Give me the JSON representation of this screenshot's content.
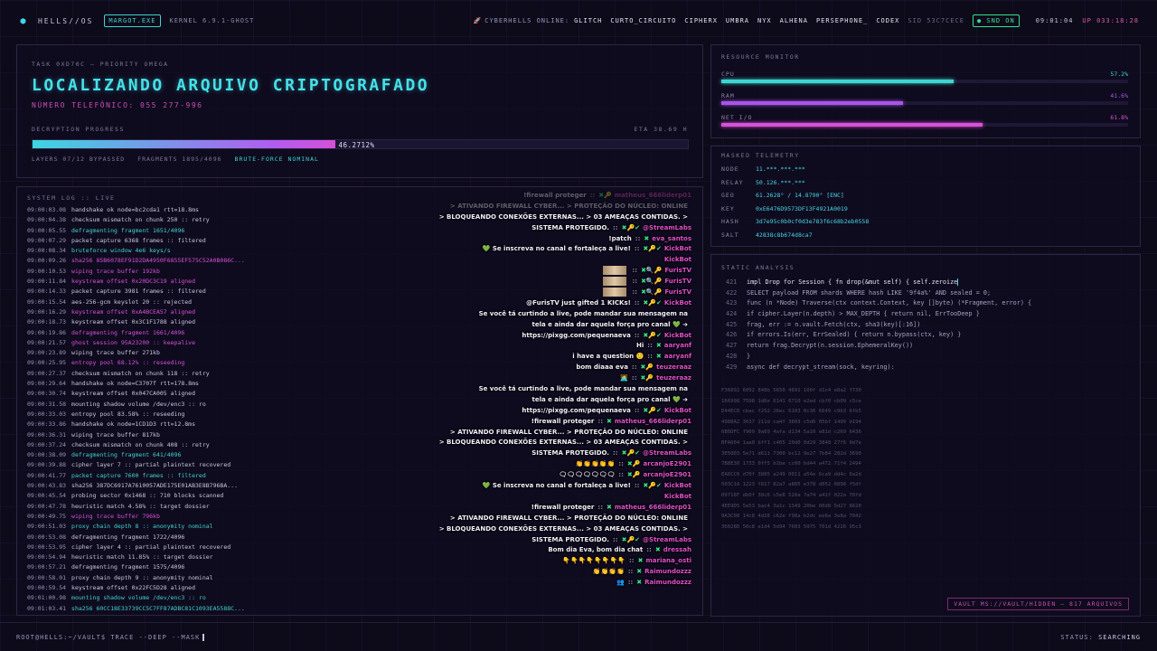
{
  "topbar": {
    "brand": "HELLS//OS",
    "process": "MARGOT.EXE",
    "kernel": "KERNEL 6.9.1-GHOST",
    "online_label": "CYBERHELLS ONLINE:",
    "users": [
      "GLITCH",
      "CURTO_CIRCUITO",
      "CIPHERX",
      "UMBRA",
      "NYX",
      "ALHENA",
      "PERSEPHONE_",
      "CODEX"
    ],
    "sid": "SID 53C7CECE",
    "snd": "SND ON",
    "clock": "09:01:04",
    "uptime": "UP 033:18:28"
  },
  "task": {
    "label": "TASK 0XD70C — PRIORITY OMEGA",
    "heading": "LOCALIZANDO ARQUIVO CRIPTOGRAFADO",
    "phone": "NÚMERO TELEFÔNICO: 055 277-996",
    "progress_label": "DECRYPTION PROGRESS",
    "eta": "ETA 38.69 H",
    "progress_value": 0.462712,
    "progress_text": "46.2712%",
    "stats": [
      "LAYERS 07/12 BYPASSED",
      "FRAGMENTS 1895/4096",
      "BRUTE-FORCE NOMINAL"
    ]
  },
  "log": {
    "title": "SYSTEM LOG :: LIVE",
    "lines": [
      {
        "t": "09:00:03.08",
        "m": "handshake ok node=bc2cda1 rtt=18.8ms",
        "c": ""
      },
      {
        "t": "09:00:04.38",
        "m": "checksum mismatch on chunk 250 :: retry",
        "c": ""
      },
      {
        "t": "09:00:05.55",
        "m": "defragmenting fragment 1651/4096",
        "c": "cyan"
      },
      {
        "t": "09:00:07.29",
        "m": "packet capture 6368 frames :: filtered",
        "c": ""
      },
      {
        "t": "09:00:08.34",
        "m": "bruteforce window 4e6 keys/s",
        "c": "cyan"
      },
      {
        "t": "09:00:09.26",
        "m": "sha256 85B6078EF91D2DA4950F6855EF575C52A0B086C...",
        "c": "mag"
      },
      {
        "t": "09:00:10.53",
        "m": "wiping trace buffer 192kb",
        "c": "mag"
      },
      {
        "t": "09:00:11.84",
        "m": "keystream offset 0x20DC3C19 aligned",
        "c": "mag"
      },
      {
        "t": "09:00:14.33",
        "m": "packet capture 3981 frames :: filtered",
        "c": ""
      },
      {
        "t": "09:00:15.54",
        "m": "aes-256-gcm keyslot 20 :: rejected",
        "c": ""
      },
      {
        "t": "09:00:16.29",
        "m": "keystream offset 0xA4BCEA57 aligned",
        "c": "mag"
      },
      {
        "t": "09:00:18.73",
        "m": "keystream offset 0x3C1F1788 aligned",
        "c": ""
      },
      {
        "t": "09:00:19.86",
        "m": "defragmenting fragment 1661/4096",
        "c": "mag"
      },
      {
        "t": "09:00:21.57",
        "m": "ghost session 95A23200 :: keepalive",
        "c": "mag"
      },
      {
        "t": "09:00:23.89",
        "m": "wiping trace buffer 271kb",
        "c": ""
      },
      {
        "t": "09:00:25.95",
        "m": "entropy pool 68.12% :: reseeding",
        "c": "mag"
      },
      {
        "t": "09:00:27.37",
        "m": "checksum mismatch on chunk 118 :: retry",
        "c": ""
      },
      {
        "t": "09:00:29.64",
        "m": "handshake ok node=C3707f rtt=178.8ms",
        "c": ""
      },
      {
        "t": "09:00:30.74",
        "m": "keystream offset 0x047CA005 aligned",
        "c": ""
      },
      {
        "t": "09:00:31.58",
        "m": "mounting shadow volume /dev/enc3 :: ro",
        "c": ""
      },
      {
        "t": "09:00:33.03",
        "m": "entropy pool 83.58% :: reseeding",
        "c": ""
      },
      {
        "t": "09:00:33.86",
        "m": "handshake ok node=1CD1D3 rtt=12.8ms",
        "c": ""
      },
      {
        "t": "09:00:36.31",
        "m": "wiping trace buffer 817kb",
        "c": ""
      },
      {
        "t": "09:00:37.24",
        "m": "checksum mismatch on chunk 408 :: retry",
        "c": ""
      },
      {
        "t": "09:00:38.09",
        "m": "defragmenting fragment 641/4096",
        "c": "cyan"
      },
      {
        "t": "09:00:39.88",
        "m": "cipher layer 7 :: partial plaintext recovered",
        "c": ""
      },
      {
        "t": "09:00:41.77",
        "m": "packet capture 7600 frames :: filtered",
        "c": "cyan"
      },
      {
        "t": "09:00:43.83",
        "m": "sha256 387DC6917A7610057ADE175E01AB3E8B796BA...",
        "c": ""
      },
      {
        "t": "09:00:45.54",
        "m": "probing sector 0x1468 :: 710 blocks scanned",
        "c": ""
      },
      {
        "t": "09:00:47.78",
        "m": "heuristic match 4.58% :: target dossier",
        "c": ""
      },
      {
        "t": "09:00:49.75",
        "m": "wiping trace buffer 796kb",
        "c": "mag"
      },
      {
        "t": "09:00:51.03",
        "m": "proxy chain depth 8 :: anonymity nominal",
        "c": "cyan"
      },
      {
        "t": "09:00:53.08",
        "m": "defragmenting fragment 1722/4096",
        "c": ""
      },
      {
        "t": "09:00:53.95",
        "m": "cipher layer 4 :: partial plaintext recovered",
        "c": ""
      },
      {
        "t": "09:00:54.94",
        "m": "heuristic match 11.85% :: target dossier",
        "c": ""
      },
      {
        "t": "09:00:57.21",
        "m": "defragmenting fragment 1575/4096",
        "c": ""
      },
      {
        "t": "09:00:58.01",
        "m": "proxy chain depth 9 :: anonymity nominal",
        "c": ""
      },
      {
        "t": "09:00:59.54",
        "m": "keystream offset 0x22FC5D28 aligned",
        "c": ""
      },
      {
        "t": "09:01:00.98",
        "m": "mounting shadow volume /dev/enc3 :: ro",
        "c": "cyan"
      },
      {
        "t": "09:01:03.41",
        "m": "sha256 60CC18E33739CC5C7FF87ADBC81C1093EA5588C...",
        "c": "cyan"
      }
    ]
  },
  "chat": [
    {
      "msg": "!firewall proteger",
      "user": "matheus_666liderp01",
      "dim": true,
      "badges": "✖🔑",
      "uc": ""
    },
    {
      "msg": "> ATIVANDO FIREWALL CYBER... > PROTEÇÃO DO NÚCLEO: ONLINE",
      "user": "",
      "dim": true,
      "badges": "",
      "uc": ""
    },
    {
      "msg": "> BLOQUEANDO CONEXÕES EXTERNAS... > 03 AMEAÇAS CONTIDAS. >",
      "user": "",
      "dim": false,
      "badges": "",
      "uc": ""
    },
    {
      "msg": "SISTEMA PROTEGIDO.",
      "user": "@StreamLabs",
      "dim": false,
      "badges": "✖🔑✔",
      "uc": ""
    },
    {
      "msg": "!patch",
      "user": "eva_santos",
      "dim": false,
      "badges": "✖",
      "uc": ""
    },
    {
      "msg": "💚 Se inscreva no canal e fortaleça a live!",
      "user": "KickBot",
      "dim": false,
      "badges": "✖🔑✔",
      "uc": ""
    },
    {
      "msg": "",
      "user": "KickBot",
      "dim": false,
      "badges": "",
      "uc": ""
    },
    {
      "msg": "EMOTE",
      "user": "FurisTV",
      "dim": false,
      "badges": "✖🔍🔑",
      "uc": ""
    },
    {
      "msg": "EMOTE",
      "user": "FurisTV",
      "dim": false,
      "badges": "✖🔍🔑",
      "uc": ""
    },
    {
      "msg": "EMOTE",
      "user": "FurisTV",
      "dim": false,
      "badges": "✖🔍🔑",
      "uc": ""
    },
    {
      "msg": "@FurisTV just gifted 1 KICKs!",
      "user": "KickBot",
      "dim": false,
      "badges": "✖🔑✔",
      "uc": ""
    },
    {
      "msg": "Se você tá curtindo a live, pode mandar sua mensagem na",
      "user": "",
      "dim": false,
      "badges": "",
      "uc": ""
    },
    {
      "msg": "tela e ainda dar aquela força pro canal 💚 ➜",
      "user": "",
      "dim": false,
      "badges": "",
      "uc": ""
    },
    {
      "msg": "https://pixgg.com/pequenaeva",
      "user": "KickBot",
      "dim": false,
      "badges": "✖🔑✔",
      "uc": ""
    },
    {
      "msg": "Hi",
      "user": "aaryanf",
      "dim": false,
      "badges": "✖",
      "uc": ""
    },
    {
      "msg": "i have a question 🙂",
      "user": "aaryanf",
      "dim": false,
      "badges": "✖",
      "uc": ""
    },
    {
      "msg": "bom diaaa eva",
      "user": "teuzeraaz",
      "dim": false,
      "badges": "✖🔑",
      "uc": ""
    },
    {
      "msg": "🧑‍💻",
      "user": "teuzeraaz",
      "dim": false,
      "badges": "✖🔑",
      "uc": ""
    },
    {
      "msg": "Se você tá curtindo a live, pode mandar sua mensagem na",
      "user": "",
      "dim": false,
      "badges": "",
      "uc": ""
    },
    {
      "msg": "tela e ainda dar aquela força pro canal 💚 ➜",
      "user": "",
      "dim": false,
      "badges": "",
      "uc": ""
    },
    {
      "msg": "https://pixgg.com/pequenaeva",
      "user": "KickBot",
      "dim": false,
      "badges": "✖🔑✔",
      "uc": ""
    },
    {
      "msg": "!firewall proteger",
      "user": "matheus_666liderp01",
      "dim": false,
      "badges": "✖",
      "uc": ""
    },
    {
      "msg": "> ATIVANDO FIREWALL CYBER... > PROTEÇÃO DO NÚCLEO: ONLINE",
      "user": "",
      "dim": false,
      "badges": "",
      "uc": ""
    },
    {
      "msg": "> BLOQUEANDO CONEXÕES EXTERNAS... > 03 AMEAÇAS CONTIDAS. >",
      "user": "",
      "dim": false,
      "badges": "",
      "uc": ""
    },
    {
      "msg": "SISTEMA PROTEGIDO.",
      "user": "@StreamLabs",
      "dim": false,
      "badges": "✖🔑✔",
      "uc": ""
    },
    {
      "msg": "👏👏👏👏👏",
      "user": "arcanjoE2901",
      "dim": false,
      "badges": "✖🔑",
      "uc": ""
    },
    {
      "msg": "🗨🗨🗨🗨🗨🗨🗨",
      "user": "arcanjoE2901",
      "dim": false,
      "badges": "✖🔑",
      "uc": ""
    },
    {
      "msg": "💚 Se inscreva no canal e fortaleça a live!",
      "user": "KickBot",
      "dim": false,
      "badges": "✖🔑✔",
      "uc": ""
    },
    {
      "msg": "",
      "user": "KickBot",
      "dim": false,
      "badges": "",
      "uc": ""
    },
    {
      "msg": "!firewall proteger",
      "user": "matheus_666liderp01",
      "dim": false,
      "badges": "✖",
      "uc": ""
    },
    {
      "msg": "> ATIVANDO FIREWALL CYBER... > PROTEÇÃO DO NÚCLEO: ONLINE",
      "user": "",
      "dim": false,
      "badges": "",
      "uc": ""
    },
    {
      "msg": "> BLOQUEANDO CONEXÕES EXTERNAS... > 03 AMEAÇAS CONTIDAS. >",
      "user": "",
      "dim": false,
      "badges": "",
      "uc": ""
    },
    {
      "msg": "SISTEMA PROTEGIDO.",
      "user": "@StreamLabs",
      "dim": false,
      "badges": "✖🔑✔",
      "uc": ""
    },
    {
      "msg": "Bom dia Eva, bom dia chat",
      "user": "dressah",
      "dim": false,
      "badges": "✖",
      "uc": ""
    },
    {
      "msg": "👇👇👇👇👇👇👇👇",
      "user": "mariana_osti",
      "dim": false,
      "badges": "✖",
      "uc": ""
    },
    {
      "msg": "👏👏👏👏",
      "user": "Raimundozzz",
      "dim": false,
      "badges": "✖",
      "uc": ""
    },
    {
      "msg": "👥",
      "user": "Raimundozzz",
      "dim": false,
      "badges": "✖",
      "uc": ""
    }
  ],
  "resources": {
    "title": "RESOURCE MONITOR",
    "meters": [
      {
        "label": "CPU",
        "value_text": "57.2%",
        "value": 0.572,
        "color": "#3ed4d0"
      },
      {
        "label": "RAM",
        "value_text": "41.6%",
        "value": 0.446,
        "color": "#a855e8"
      },
      {
        "label": "NET I/O",
        "value_text": "61.8%",
        "value": 0.642,
        "color": "#d650d8"
      }
    ]
  },
  "telemetry": {
    "title": "MASKED TELEMETRY",
    "rows": [
      {
        "k": "NODE",
        "v": "11.***.***.***"
      },
      {
        "k": "RELAY",
        "v": "50.126.***.***"
      },
      {
        "k": "GEO",
        "v": "61.2628° / 14.8790° [ENC]"
      },
      {
        "k": "KEY",
        "v": "0xE6476D9573DF13F4921A0019"
      },
      {
        "k": "HASH",
        "v": "3d7e95c0b0cf0d3e783f6c68b2eb0558"
      },
      {
        "k": "SALT",
        "v": "42838c8b674d8ca7"
      }
    ]
  },
  "analysis": {
    "title": "STATIC ANALYSIS",
    "code": [
      {
        "n": "421",
        "s": "impl Drop for Session { fn drop(&mut self) { self.zeroize",
        "hl": true
      },
      {
        "n": "422",
        "s": "SELECT payload FROM shards WHERE hash LIKE '9f4a%' AND sealed = 0;",
        "hl": false
      },
      {
        "n": "423",
        "s": "func (n *Node) Traverse(ctx context.Context, key []byte) (*Fragment, error) {",
        "hl": false
      },
      {
        "n": "424",
        "s": "if cipher.Layer(n.depth) > MAX_DEPTH { return nil, ErrTooDeep }",
        "hl": false
      },
      {
        "n": "425",
        "s": "frag, err := n.vault.Fetch(ctx, sha3(key)[:16])",
        "hl": false
      },
      {
        "n": "426",
        "s": "if errors.Is(err, ErrSealed) { return n.bypass(ctx, key) }",
        "hl": false
      },
      {
        "n": "427",
        "s": "return frag.Decrypt(n.session.EphemeralKey())",
        "hl": false
      },
      {
        "n": "428",
        "s": "}",
        "hl": false
      },
      {
        "n": "429",
        "s": "async def decrypt_stream(sock, keyring):",
        "hl": false
      }
    ],
    "hex": [
      "F36892 6092 848b 5650 4691 100f d1c4 e8a2 f730",
      "166998 7598 1d6e 6141 0710 e2ed cbf0 cb09 c5ce",
      "D44ECD cbac f252 26ec 6103 0c36 6649 c9b3 6fb5",
      "4988A2 3637 211d ca4f 3603 c5d6 05bf 1499 b194",
      "6B6DFC f909 9a69 4afa d134 5a10 e81d c269 6436",
      "BFA604 1aa0 bff1 c465 20d0 0d29 3848 27f6 0d7e",
      "3E50D3 5e71 d611 7300 bc12 9e27 7b84 282d 3690",
      "7B8E30 1733 0ff5 b1be cc60 bd44 a472 71f4 2494",
      "EA6CC6 d70f 3885 a249 0011 a54e 6ca9 dd4c 6a2d",
      "503C1A 1223 f817 82a7 a885 e378 d052 8898 f5df",
      "09716F db0f 38c6 c5e8 526a 7a74 a41f 022a 70fd",
      "4EE9D5 5e53 bac4 3a1c 1349 20be 00d8 5d27 6620",
      "9A3C08 14c8 4d28 c62e f98a b2dc ee6a 3e8a 7042",
      "36028D 50c8 e1d4 5d94 7603 5975 701d 4226 95c3"
    ],
    "vault": "VAULT MS://VAULT/HIDDEN — 817 ARQUIVOS"
  },
  "bottombar": {
    "prompt": "ROOT@HELLS:~/VAULT$ TRACE --DEEP --MASK",
    "status_label": "STATUS:",
    "status_value": "SEARCHING"
  }
}
